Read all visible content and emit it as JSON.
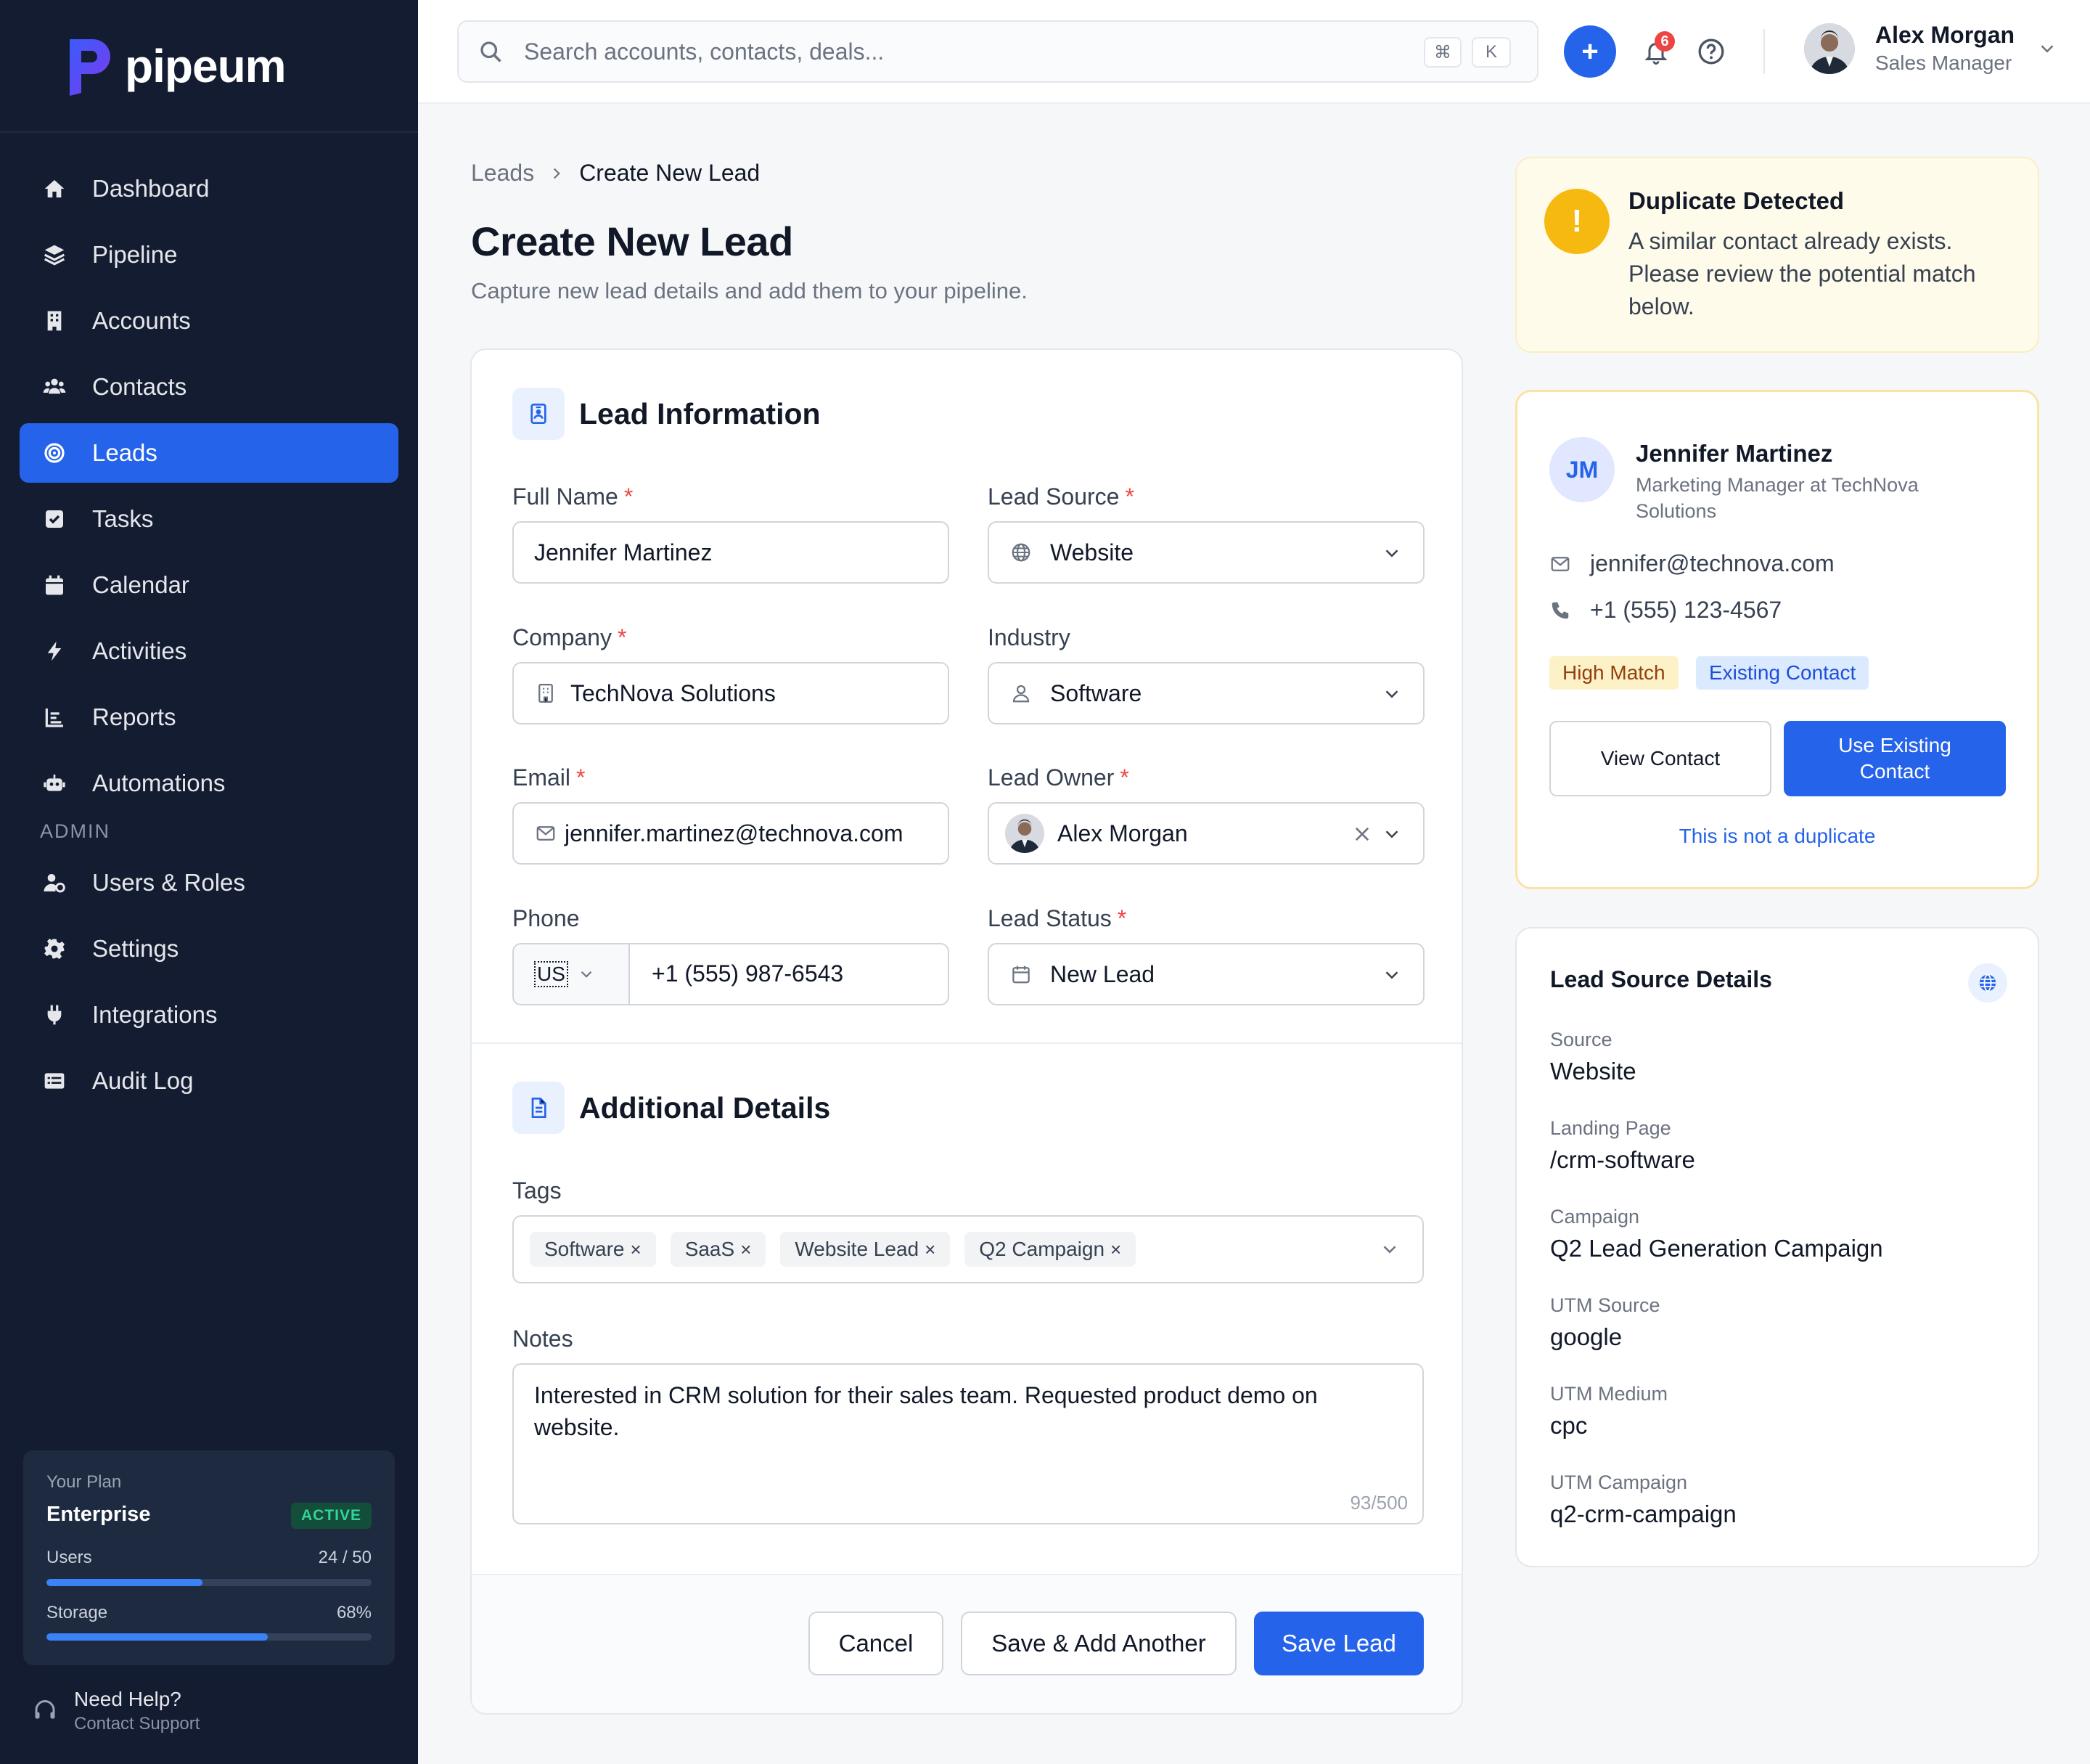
{
  "app": {
    "brand": "pipeum"
  },
  "sidebar": {
    "items": [
      {
        "label": "Dashboard",
        "icon": "home-icon"
      },
      {
        "label": "Pipeline",
        "icon": "layers-icon"
      },
      {
        "label": "Accounts",
        "icon": "building-icon"
      },
      {
        "label": "Contacts",
        "icon": "users-icon"
      },
      {
        "label": "Leads",
        "icon": "target-icon",
        "active": true
      },
      {
        "label": "Tasks",
        "icon": "checkbox-icon"
      },
      {
        "label": "Calendar",
        "icon": "calendar-icon"
      },
      {
        "label": "Activities",
        "icon": "bolt-icon"
      },
      {
        "label": "Reports",
        "icon": "chart-icon"
      },
      {
        "label": "Automations",
        "icon": "robot-icon"
      }
    ],
    "admin_label": "ADMIN",
    "admin_items": [
      {
        "label": "Users & Roles",
        "icon": "user-gear-icon"
      },
      {
        "label": "Settings",
        "icon": "gear-icon"
      },
      {
        "label": "Integrations",
        "icon": "plug-icon"
      },
      {
        "label": "Audit Log",
        "icon": "list-icon"
      }
    ],
    "plan": {
      "label": "Your Plan",
      "name": "Enterprise",
      "status": "ACTIVE",
      "users_label": "Users",
      "users_value": "24 / 50",
      "users_fraction": 0.48,
      "storage_label": "Storage",
      "storage_value": "68%",
      "storage_fraction": 0.68
    },
    "help": {
      "title": "Need Help?",
      "subtitle": "Contact Support"
    }
  },
  "topbar": {
    "search_placeholder": "Search accounts, contacts, deals...",
    "shortcut_1": "⌘",
    "shortcut_2": "K",
    "add_label": "+",
    "notification_count": "6",
    "user_name": "Alex Morgan",
    "user_role": "Sales Manager"
  },
  "breadcrumb": {
    "parent": "Leads",
    "current": "Create New Lead"
  },
  "page": {
    "title": "Create New Lead",
    "subtitle": "Capture new lead details and add them to your pipeline."
  },
  "form": {
    "lead_info_title": "Lead Information",
    "full_name_label": "Full Name",
    "full_name_value": "Jennifer Martinez",
    "lead_source_label": "Lead Source",
    "lead_source_value": "Website",
    "company_label": "Company",
    "company_value": "TechNova Solutions",
    "industry_label": "Industry",
    "industry_value": "Software",
    "email_label": "Email",
    "email_value": "jennifer.martinez@technova.com",
    "lead_owner_label": "Lead Owner",
    "lead_owner_value": "Alex Morgan",
    "phone_label": "Phone",
    "phone_country": "US",
    "phone_value": "+1 (555) 987-6543",
    "lead_status_label": "Lead Status",
    "lead_status_value": "New Lead",
    "required_mark": "*",
    "additional_title": "Additional Details",
    "tags_label": "Tags",
    "tags": [
      "Software",
      "SaaS",
      "Website Lead",
      "Q2 Campaign"
    ],
    "tag_remove": "×",
    "notes_label": "Notes",
    "notes_value": "Interested in CRM solution for their sales team. Requested product demo on website.",
    "notes_count": "93/500",
    "cancel_label": "Cancel",
    "save_add_label": "Save & Add Another",
    "save_label": "Save Lead"
  },
  "duplicate": {
    "icon_text": "!",
    "title": "Duplicate Detected",
    "description": "A similar contact already exists. Please review the potential match below."
  },
  "match": {
    "initials": "JM",
    "name": "Jennifer Martinez",
    "role": "Marketing Manager at TechNova Solutions",
    "email": "jennifer@technova.com",
    "phone": "+1 (555) 123-4567",
    "badge_match": "High Match",
    "badge_existing": "Existing Contact",
    "view_label": "View Contact",
    "use_label": "Use Existing Contact",
    "not_duplicate_label": "This is not a duplicate"
  },
  "source_details": {
    "title": "Lead Source Details",
    "rows": [
      {
        "label": "Source",
        "value": "Website"
      },
      {
        "label": "Landing Page",
        "value": "/crm-software"
      },
      {
        "label": "Campaign",
        "value": "Q2 Lead Generation Campaign"
      },
      {
        "label": "UTM Source",
        "value": "google"
      },
      {
        "label": "UTM Medium",
        "value": "cpc"
      },
      {
        "label": "UTM Campaign",
        "value": "q2-crm-campaign"
      }
    ]
  },
  "colors": {
    "sidebar_bg": "#131c31",
    "accent": "#2563eb",
    "warning": "#f5b910",
    "danger": "#ef4444"
  }
}
